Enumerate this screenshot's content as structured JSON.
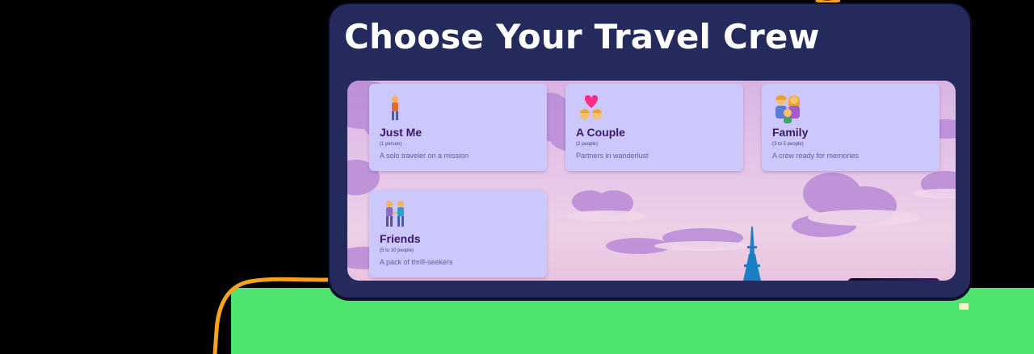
{
  "page": {
    "title": "Choose Your Travel Crew"
  },
  "options": [
    {
      "icon": "single-person-icon",
      "name": "Just Me",
      "count": "(1 person)",
      "description": "A solo traveler on a mission"
    },
    {
      "icon": "couple-with-heart-icon",
      "name": "A Couple",
      "count": "(2 people)",
      "description": "Partners in wanderlust"
    },
    {
      "icon": "family-icon",
      "name": "Family",
      "count": "(3 to 5 people)",
      "description": "A crew ready for memories"
    },
    {
      "icon": "friends-holding-hands-icon",
      "name": "Friends",
      "count": "(5 to 10 people)",
      "description": "A pack of thrill-seekers"
    }
  ],
  "colors": {
    "panel": "#242a5c",
    "card": "#cdc8fb",
    "card_title": "#3a1869",
    "sky": "#e6c6e8",
    "clouds": "#b98ad6",
    "tower": "#1b7fc4",
    "green_band": "#4fe36f",
    "wire": "#f7a31c"
  }
}
